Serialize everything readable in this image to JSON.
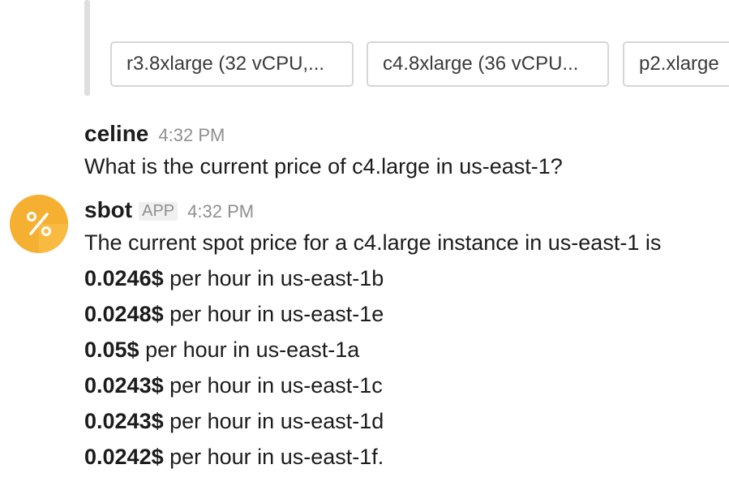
{
  "attachment": {
    "buttons": [
      {
        "label": "r3.8xlarge (32 vCPU,..."
      },
      {
        "label": "c4.8xlarge (36 vCPU..."
      },
      {
        "label": "p2.xlarge"
      }
    ]
  },
  "messages": [
    {
      "author": "celine",
      "time": "4:32 PM",
      "text": "What is the current price of c4.large in us-east-1?"
    },
    {
      "author": "sbot",
      "badge": "APP",
      "time": "4:32 PM",
      "avatar_icon": "percent-icon",
      "avatar_color": "#f6b031",
      "intro": "The current spot price for a c4.large instance in us-east-1 is",
      "prices": [
        {
          "price": "0.0246$",
          "rest": " per hour in us-east-1b"
        },
        {
          "price": "0.0248$",
          "rest": " per hour in us-east-1e"
        },
        {
          "price": "0.05$",
          "rest": " per hour in us-east-1a"
        },
        {
          "price": "0.0243$",
          "rest": " per hour in us-east-1c"
        },
        {
          "price": "0.0243$",
          "rest": " per hour in us-east-1d"
        },
        {
          "price": "0.0242$",
          "rest": " per hour in us-east-1f."
        }
      ]
    }
  ]
}
